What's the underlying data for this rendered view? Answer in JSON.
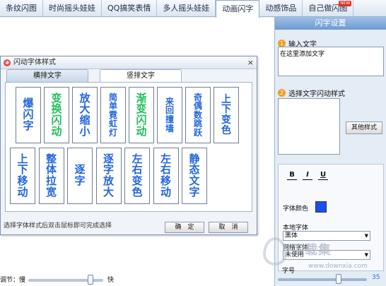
{
  "tabs": [
    {
      "label": "条纹闪图",
      "active": false
    },
    {
      "label": "时尚摇头娃娃",
      "active": false
    },
    {
      "label": "QQ搞笑表情",
      "active": false
    },
    {
      "label": "多人摇头娃娃",
      "active": false
    },
    {
      "label": "动画闪字",
      "active": true
    },
    {
      "label": "动感饰品",
      "active": false
    },
    {
      "label": "自己做闪图",
      "active": false,
      "badge": "NEW"
    }
  ],
  "panel": {
    "title": "闪字设置",
    "step1_num": "1",
    "step1_label": "输入文字",
    "text_value": "在这里添加文字",
    "step2_num": "2",
    "step2_label": "选择文字闪动样式",
    "other_styles": "其他样式",
    "bold": "B",
    "italic": "I",
    "underline": "U",
    "color_label": "字体颜色",
    "local_font_label": "本地字体",
    "local_font_value": "黑体",
    "web_font_label": "网络字体",
    "web_font_value": "未使用",
    "size_label": "字号",
    "size_value": "35",
    "font_color": "#1a4ff0"
  },
  "dialog": {
    "title": "闪动字体样式",
    "tab_horizontal": "横排文字",
    "tab_vertical": "竖排文字",
    "hint": "选择字体样式后双击鼠标即可完成选择",
    "ok": "确　定",
    "cancel": "取　消",
    "styles_row1": [
      {
        "text": "爆闪字",
        "color": "#2266dd",
        "size": 15
      },
      {
        "text": "变换闪动",
        "color": "#1fbf5a",
        "size": 15
      },
      {
        "text": "放大缩小",
        "color": "#2266dd",
        "size": 15
      },
      {
        "text": "简单霓虹灯",
        "color": "#2266dd",
        "size": 12
      },
      {
        "text": "渐变闪动",
        "color": "#1fbf5a",
        "size": 15
      },
      {
        "text": "来回撞墙",
        "color": "#2266dd",
        "size": 12
      },
      {
        "text": "奇偶数跳跃",
        "color": "#2266dd",
        "size": 12
      },
      {
        "text": "上下变色",
        "color": "#2266dd",
        "size": 14
      }
    ],
    "styles_row2": [
      {
        "text": "上下移动",
        "color": "#2266dd",
        "size": 15
      },
      {
        "text": "整体拉宽",
        "color": "#2266dd",
        "size": 15
      },
      {
        "text": "逐字",
        "color": "#2266dd",
        "size": 15
      },
      {
        "text": "逐字放大",
        "color": "#2266dd",
        "size": 15
      },
      {
        "text": "左右变色",
        "color": "#2266dd",
        "size": 15
      },
      {
        "text": "左右移动",
        "color": "#2266dd",
        "size": 15
      },
      {
        "text": "静态文字",
        "color": "#2266dd",
        "size": 15
      }
    ]
  },
  "speed": {
    "label": "调节：慢",
    "fast": "快",
    "level": 0.83
  },
  "watermark": {
    "text": "下载集",
    "url": "www.downxia.com"
  }
}
